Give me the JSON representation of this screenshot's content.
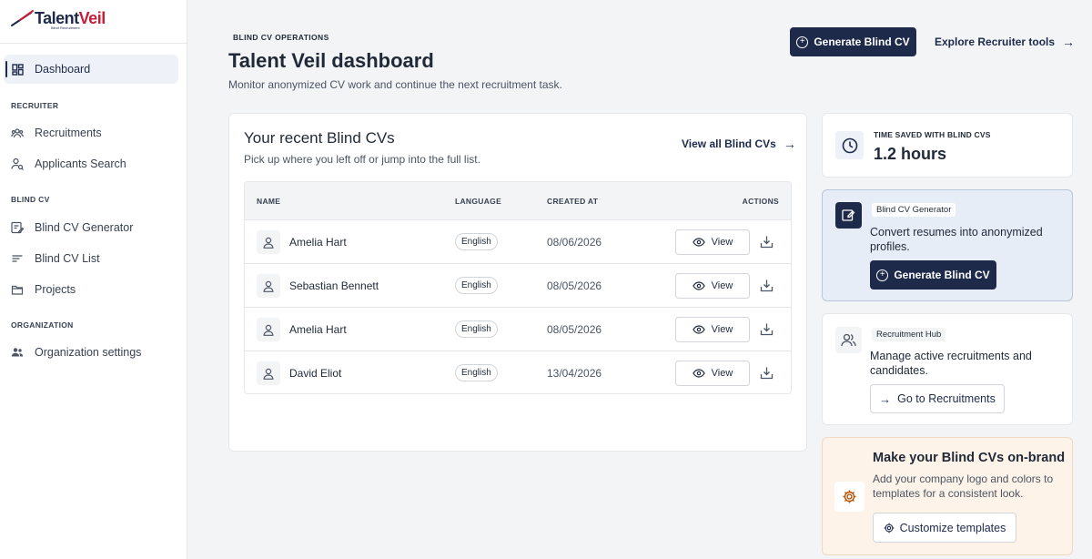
{
  "brand": {
    "name_part1": "Talent",
    "name_part2": "Veil",
    "tagline": "Blind Recruitment"
  },
  "sidebar": {
    "dashboard": "Dashboard",
    "section_recruiter": "RECRUITER",
    "recruitments": "Recruitments",
    "applicants_search": "Applicants Search",
    "section_blind_cv": "BLIND CV",
    "blind_cv_generator": "Blind CV Generator",
    "blind_cv_list": "Blind CV List",
    "projects": "Projects",
    "section_organization": "ORGANIZATION",
    "organization_settings": "Organization settings"
  },
  "header": {
    "eyebrow": "BLIND CV OPERATIONS",
    "title": "Talent Veil dashboard",
    "subtitle": "Monitor anonymized CV work and continue the next recruitment task.",
    "primary_button": "Generate Blind CV",
    "secondary_link": "Explore Recruiter tools"
  },
  "recent": {
    "title": "Your recent Blind CVs",
    "subtitle": "Pick up where you left off or jump into the full list.",
    "view_all": "View all Blind CVs",
    "columns": {
      "name": "NAME",
      "language": "LANGUAGE",
      "created": "CREATED AT",
      "actions": "ACTIONS"
    },
    "view_label": "View",
    "rows": [
      {
        "name": "Amelia Hart",
        "language": "English",
        "created": "08/06/2026"
      },
      {
        "name": "Sebastian Bennett",
        "language": "English",
        "created": "08/05/2026"
      },
      {
        "name": "Amelia Hart",
        "language": "English",
        "created": "08/05/2026"
      },
      {
        "name": "David Eliot",
        "language": "English",
        "created": "13/04/2026"
      }
    ]
  },
  "time_saved": {
    "label": "TIME SAVED WITH BLIND CVS",
    "value": "1.2 hours"
  },
  "generator_card": {
    "chip": "Blind CV Generator",
    "text": "Convert resumes into anonymized profiles.",
    "button": "Generate Blind CV"
  },
  "hub_card": {
    "chip": "Recruitment Hub",
    "text": "Manage active recruitments and candidates.",
    "button": "Go to Recruitments"
  },
  "brand_card": {
    "title": "Make your Blind CVs on-brand",
    "text": "Add your company logo and colors to templates for a consistent look.",
    "button": "Customize templates"
  },
  "colors": {
    "navy": "#1e2a4a",
    "accent_red": "#c81e3a",
    "gen_card_bg": "#e7edf6",
    "brand_card_bg": "#fdf3e8"
  }
}
